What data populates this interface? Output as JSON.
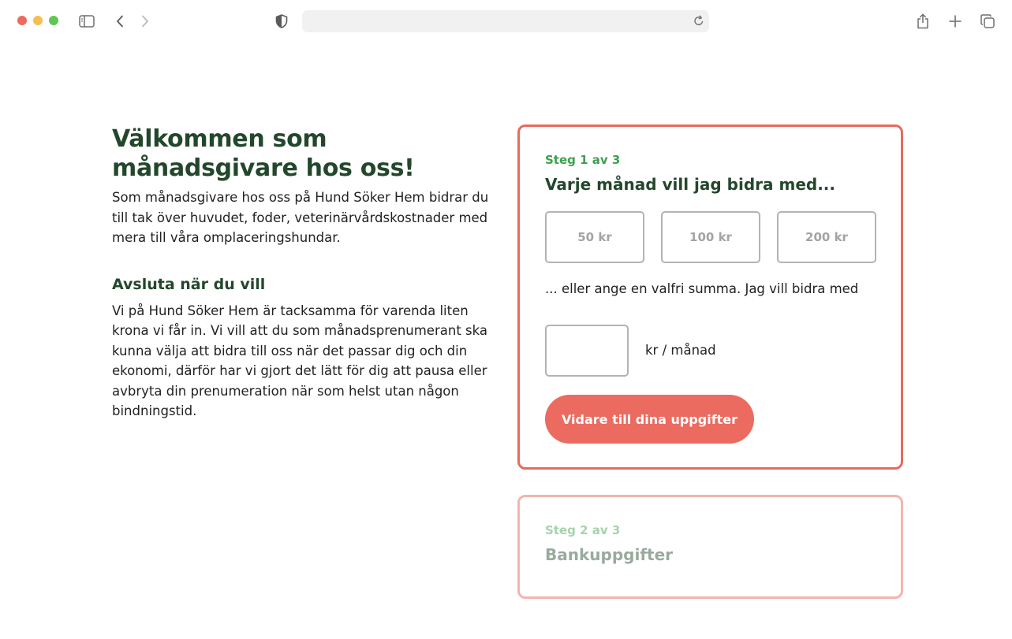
{
  "page": {
    "heading": "Välkommen som månadsgivare hos oss!",
    "intro": "Som månadsgivare hos oss på Hund Söker Hem bidrar du till tak över huvudet, foder, veterinärvårdskostnader med mera till våra omplaceringshundar.",
    "subheading": "Avsluta när du vill",
    "body": "Vi på Hund Söker Hem är tacksamma för varenda liten krona vi får in. Vi vill att du som månadsprenumerant ska kunna välja att bidra till oss när det passar dig och din ekonomi, därför har vi gjort det lätt för dig att pausa eller avbryta din prenumeration när som helst utan någon bindningstid."
  },
  "step1": {
    "step_label": "Steg 1 av 3",
    "title": "Varje månad vill jag bidra med...",
    "amounts": [
      "50 kr",
      "100 kr",
      "200 kr"
    ],
    "custom_prompt": "... eller ange en valfri summa. Jag vill bidra med",
    "custom_value": "",
    "unit": "kr / månad",
    "next_label": "Vidare till dina uppgifter"
  },
  "step2": {
    "step_label": "Steg 2 av 3",
    "title": "Bankuppgifter"
  },
  "colors": {
    "brand_green": "#23472c",
    "step_green": "#3fa050",
    "accent_red": "#ec6b60"
  },
  "icons": [
    "sidebar-icon",
    "back-icon",
    "forward-icon",
    "shield-icon",
    "reload-icon",
    "share-icon",
    "new-tab-icon",
    "tabs-icon"
  ]
}
